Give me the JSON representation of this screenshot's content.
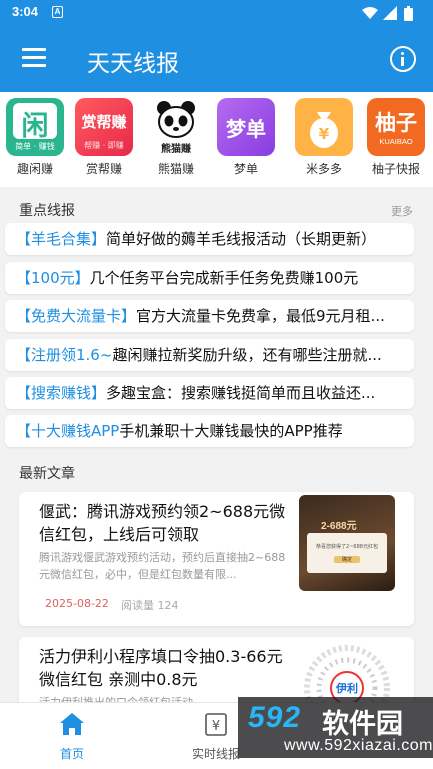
{
  "status_bar": {
    "time": "3:04",
    "notification_badge": "A"
  },
  "app_bar": {
    "title": "天天线报"
  },
  "apps": [
    {
      "name": "趣闲赚",
      "icon_text": "闲",
      "icon_sub": "简单 · 赚钱",
      "icon": "quxianzhuan-logo"
    },
    {
      "name": "赏帮赚",
      "icon_text": "赏帮赚",
      "icon_sub": "帮赚 · 即赚",
      "icon": "shangbangzhuan-logo"
    },
    {
      "name": "熊猫赚",
      "icon_text": "熊猫赚",
      "icon": "panda-logo"
    },
    {
      "name": "梦单",
      "icon_text": "梦单",
      "icon": "mengdan-logo"
    },
    {
      "name": "米多多",
      "icon": "money-bag-logo"
    },
    {
      "name": "柚子快报",
      "icon_text": "柚子",
      "icon_sub": "KUAIBAO",
      "icon": "youzi-logo"
    }
  ],
  "highlights": {
    "label": "重点线报",
    "more": "更多",
    "items": [
      {
        "tag": "【羊毛合集】",
        "text": "简单好做的薅羊毛线报活动（长期更新）"
      },
      {
        "tag": "【100元】",
        "text": "几个任务平台完成新手任务免费赚100元"
      },
      {
        "tag": "【免费大流量卡】",
        "text": "官方大流量卡免费拿，最低9元月租..."
      },
      {
        "tag": "【注册领1.6~",
        "text": "趣闲赚拉新奖励升级，还有哪些注册就..."
      },
      {
        "tag": "【搜索赚钱】",
        "text": "多趣宝盒：搜索赚钱挺简单而且收益还..."
      },
      {
        "tag": "【十大赚钱APP",
        "text": "手机兼职十大赚钱最快的APP推荐"
      }
    ]
  },
  "latest": {
    "label": "最新文章",
    "articles": [
      {
        "title": "偃武：腾讯游戏预约领2~688元微信红包，上线后可领取",
        "summary": "腾讯游戏偃武游戏预约活动，预约后直接抽2~688元微信红包，必中，但是红包数量有限...",
        "date": "2025-08-22",
        "reads": "阅读量 124",
        "thumb_text": "2-688元",
        "thumb_dialog": "恭喜您获得了2~688元红包",
        "thumb_button": "确定"
      },
      {
        "title": "活力伊利小程序填口令抽0.3-66元微信红包 亲测中0.8元",
        "summary": "活力伊利推出的口令领红包活动",
        "date": "",
        "reads": "",
        "thumb_text": "伊利"
      }
    ]
  },
  "bottom_nav": [
    {
      "label": "首页",
      "active": true
    },
    {
      "label": "实时线报",
      "active": false
    },
    {
      "label": "",
      "active": false
    },
    {
      "label": "",
      "active": false
    }
  ],
  "watermark": {
    "brand_digits": "592",
    "brand_cn": "软件园",
    "url": "www.592xiazai.com"
  },
  "colors": {
    "primary": "#1e8fe1",
    "date": "#e06060",
    "background": "#f2f2f2"
  }
}
